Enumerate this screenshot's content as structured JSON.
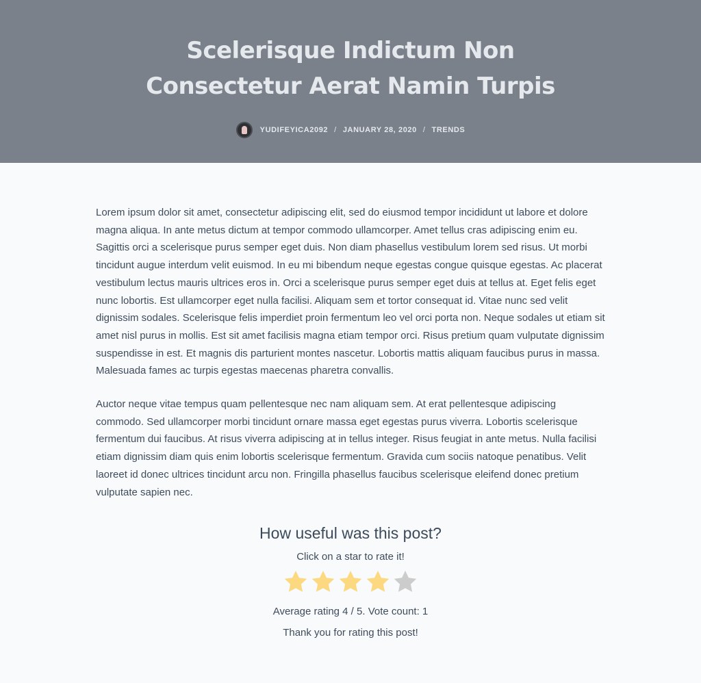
{
  "header": {
    "title": "Scelerisque Indictum Non Consectetur Aerat Namin Turpis",
    "author": "YUDIFEYICA2092",
    "separator": "/",
    "date": "JANUARY 28, 2020",
    "category": "TRENDS"
  },
  "article": {
    "paragraphs": [
      "Lorem ipsum dolor sit amet, consectetur adipiscing elit, sed do eiusmod tempor incididunt ut labore et dolore magna aliqua. In ante metus dictum at tempor commodo ullamcorper. Amet tellus cras adipiscing enim eu. Sagittis orci a scelerisque purus semper eget duis. Non diam phasellus vestibulum lorem sed risus. Ut morbi tincidunt augue interdum velit euismod. In eu mi bibendum neque egestas congue quisque egestas. Ac placerat vestibulum lectus mauris ultrices eros in. Orci a scelerisque purus semper eget duis at tellus at. Eget felis eget nunc lobortis. Est ullamcorper eget nulla facilisi. Aliquam sem et tortor consequat id. Vitae nunc sed velit dignissim sodales. Scelerisque felis imperdiet proin fermentum leo vel orci porta non. Neque sodales ut etiam sit amet nisl purus in mollis. Est sit amet facilisis magna etiam tempor orci. Risus pretium quam vulputate dignissim suspendisse in est. Et magnis dis parturient montes nascetur. Lobortis mattis aliquam faucibus purus in massa. Malesuada fames ac turpis egestas maecenas pharetra convallis.",
      "Auctor neque vitae tempus quam pellentesque nec nam aliquam sem. At erat pellentesque adipiscing commodo. Sed ullamcorper morbi tincidunt ornare massa eget egestas purus viverra. Lobortis scelerisque fermentum dui faucibus. At risus viverra adipiscing at in tellus integer. Risus feugiat in ante metus. Nulla facilisi etiam dignissim diam quis enim lobortis scelerisque fermentum. Gravida cum sociis natoque penatibus. Velit laoreet id donec ultrices tincidunt arcu non. Fringilla phasellus faucibus scelerisque eleifend donec pretium vulputate sapien nec."
    ]
  },
  "rating": {
    "heading": "How useful was this post?",
    "hint": "Click on a star to rate it!",
    "stars_total": 5,
    "stars_filled": 4,
    "average_text": "Average rating 4 / 5. Vote count: 1",
    "thanks": "Thank you for rating this post!"
  },
  "colors": {
    "hero_bg": "#7a818a",
    "star_filled": "#fcd980",
    "star_empty": "#cccccc"
  }
}
